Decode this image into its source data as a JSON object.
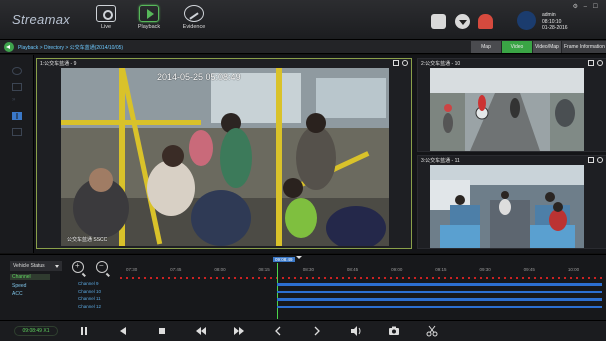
{
  "app": {
    "logo": "Streamax"
  },
  "nav": [
    {
      "label": "Live",
      "icon": "eye-icon"
    },
    {
      "label": "Playback",
      "icon": "play-icon"
    },
    {
      "label": "Evidence",
      "icon": "evidence-icon"
    }
  ],
  "user": {
    "name": "admin",
    "time": "08:10:10",
    "date": "01-28-2016"
  },
  "breadcrumb": "Playback > Directory > 公交车蓝通(2014/10/05)",
  "view_tabs": {
    "map": "Map",
    "video": "Video",
    "videomap": "Video/Map",
    "frame_info": "Frame Information"
  },
  "panels": {
    "main": {
      "title": "1:公交车蓝通 - 9",
      "osd_date": "2014-05-25 05:08:49",
      "osd_channel": "公交车蓝通  SSCC"
    },
    "side1": {
      "title": "2:公交车蓝通 - 10"
    },
    "side2": {
      "title": "3:公交车蓝通 - 11"
    }
  },
  "timeline": {
    "selector": "Vehicle Status",
    "options": [
      "Channel",
      "Speed",
      "ACC"
    ],
    "cursor_time": "09:08:49",
    "ticks": [
      "07:30",
      "07:45",
      "08:00",
      "08:15",
      "08:30",
      "08:45",
      "09:00",
      "09:15",
      "09:30",
      "09:45",
      "10:00"
    ],
    "channels": [
      "Channel 9",
      "Channel 10",
      "Channel 11",
      "Channel 12"
    ]
  },
  "controls": {
    "time": "09:08:49",
    "speed": "X1"
  },
  "colors": {
    "accent_green": "#3aa445",
    "timeline_blue": "#2c6fd1",
    "alarm_red": "#c22"
  }
}
